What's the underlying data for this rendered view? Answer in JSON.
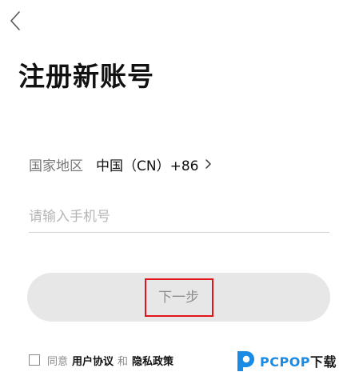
{
  "header": {
    "back_icon": "chevron-left-icon",
    "title": "注册新账号"
  },
  "region": {
    "label": "国家地区",
    "value": "中国（CN）+86",
    "chevron_icon": "chevron-right-icon"
  },
  "phone": {
    "placeholder": "请输入手机号",
    "value": ""
  },
  "next_button": {
    "label": "下一步",
    "highlight_color": "#e0141a"
  },
  "agreement": {
    "checked": false,
    "prefix": "同意",
    "user_agreement": "用户协议",
    "conjunction": "和",
    "privacy_policy": "隐私政策"
  },
  "watermark": {
    "brand": "PCPOP",
    "suffix": "下载",
    "brand_color": "#1a8be4"
  },
  "colors": {
    "button_bg": "#e7e7e7",
    "text_primary": "#111111",
    "text_secondary": "#777777",
    "placeholder": "#b5b5b5"
  }
}
